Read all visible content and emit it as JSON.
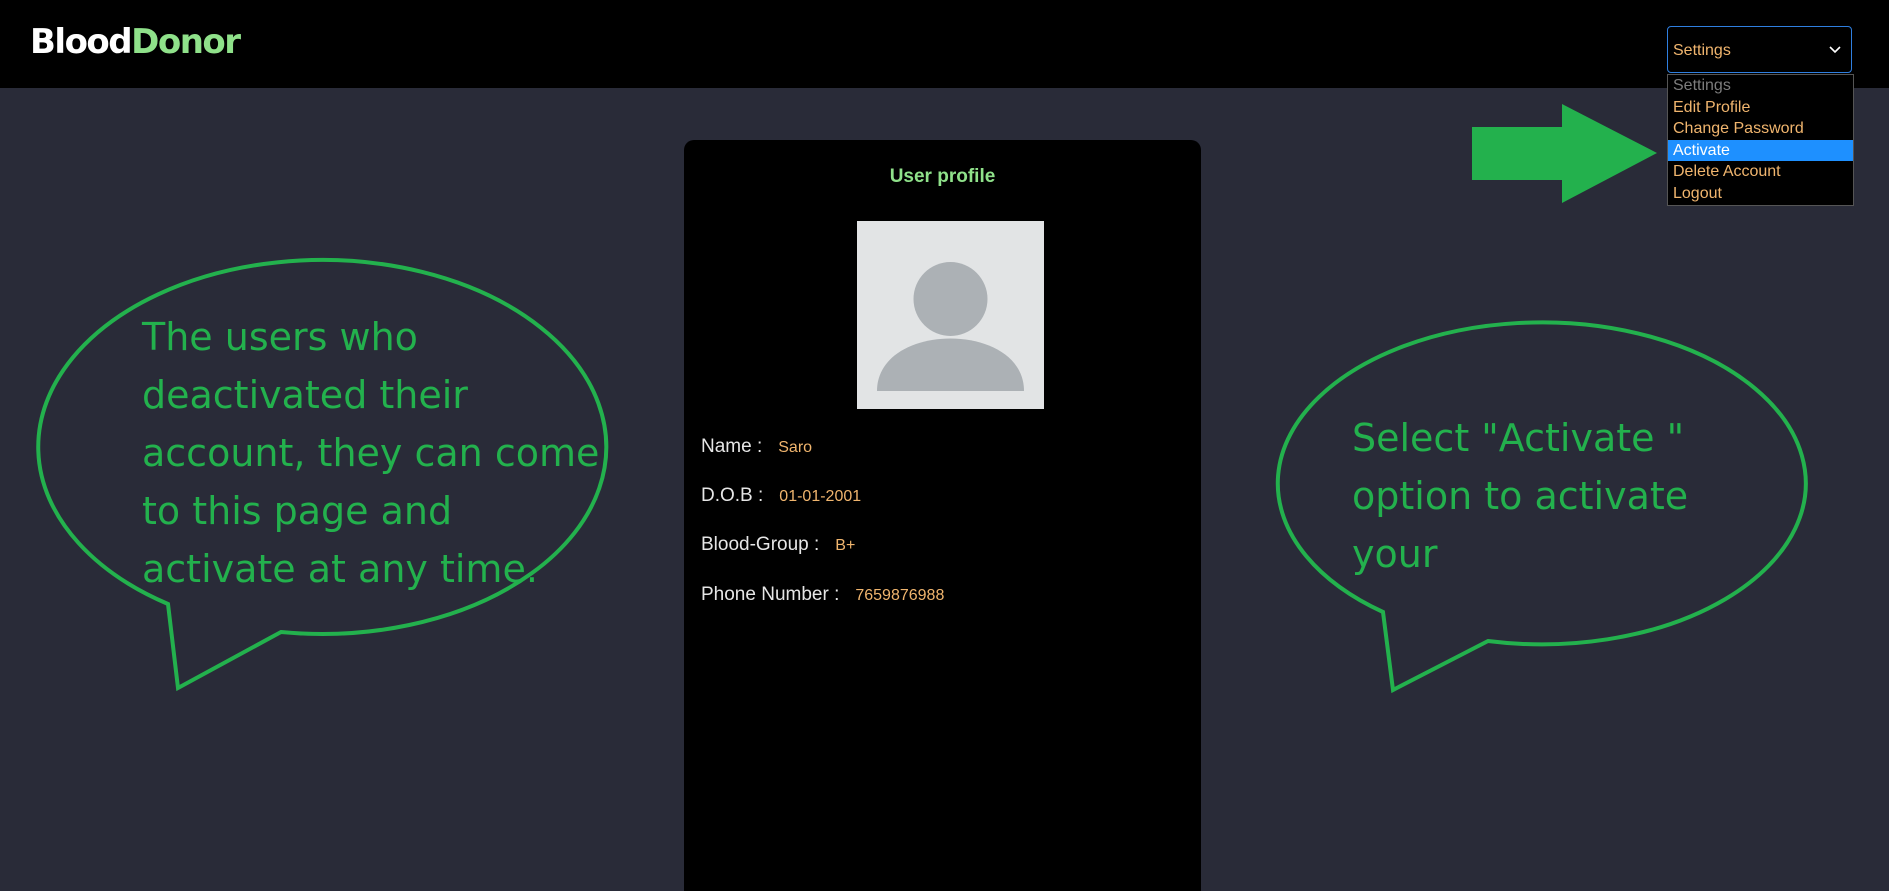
{
  "app": {
    "brand_part1": "Blood",
    "brand_part2": "Donor"
  },
  "settings": {
    "selected_label": "Settings",
    "options": [
      {
        "label": "Settings",
        "disabled": true
      },
      {
        "label": "Edit Profile"
      },
      {
        "label": "Change Password"
      },
      {
        "label": "Activate",
        "highlighted": true
      },
      {
        "label": "Delete Account"
      },
      {
        "label": "Logout"
      }
    ]
  },
  "profile": {
    "title": "User profile",
    "name_label": "Name :",
    "name": "Saro",
    "dob_label": "D.O.B :",
    "dob": "01-01-2001",
    "blood_group_label": "Blood-Group :",
    "blood_group": "B+",
    "phone_label": "Phone Number :",
    "phone": "7659876988"
  },
  "annotations": {
    "left_bubble_lines": [
      "The users who",
      "deactivated their",
      "account, they can come",
      "to this page and",
      "activate at any time."
    ],
    "right_bubble_lines": [
      "Select \"Activate \"",
      "option to activate",
      "your"
    ]
  },
  "colors": {
    "background": "#292b38",
    "navbar": "#000000",
    "accent_green": "#8fe18a",
    "value_orange": "#f0b56e",
    "annotation_green": "#23b14d",
    "highlight_blue": "#1e90ff"
  }
}
